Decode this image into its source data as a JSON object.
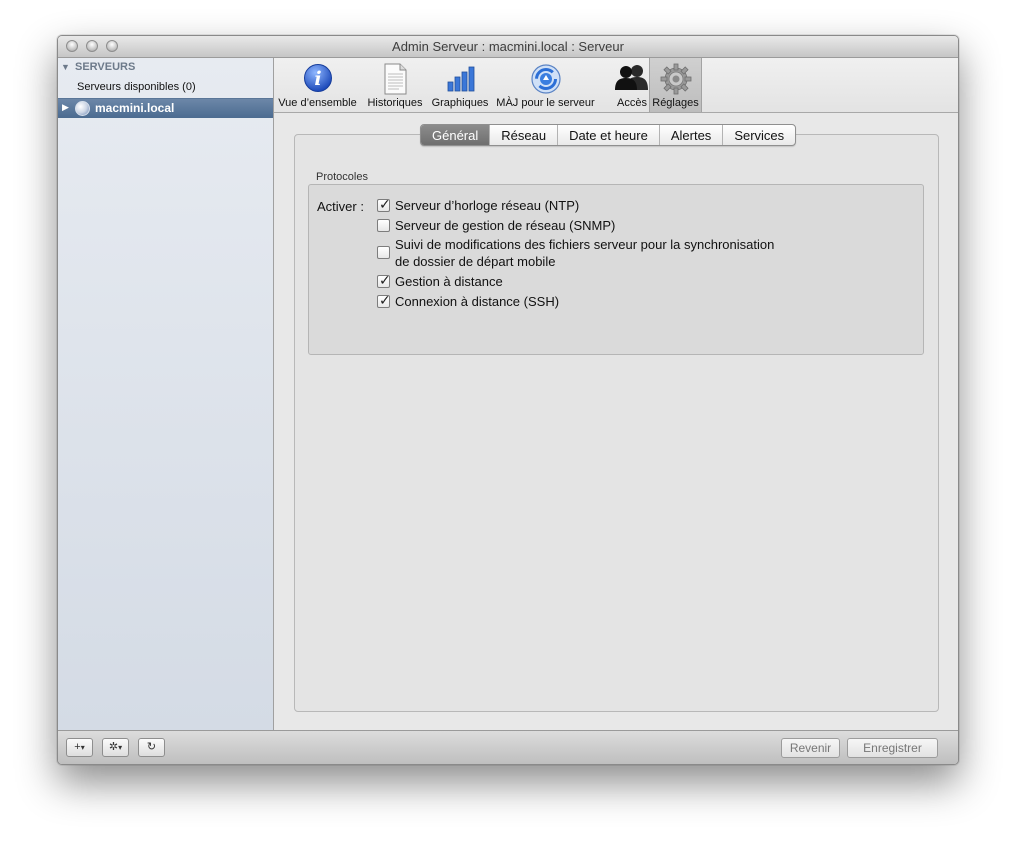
{
  "window": {
    "title": "Admin Serveur : macmini.local : Serveur"
  },
  "sidebar": {
    "header": "SERVEURS",
    "available": "Serveurs disponibles (0)",
    "selected": "macmini.local"
  },
  "toolbar": {
    "items": [
      {
        "label": "Vue d’ensemble",
        "icon": "info-icon"
      },
      {
        "label": "Historiques",
        "icon": "document-icon"
      },
      {
        "label": "Graphiques",
        "icon": "bar-chart-icon"
      },
      {
        "label": "MÀJ pour le serveur",
        "icon": "software-update-icon"
      },
      {
        "label": "Accès",
        "icon": "users-icon"
      },
      {
        "label": "Réglages",
        "icon": "gear-icon",
        "selected": true
      }
    ]
  },
  "tabs": [
    {
      "label": "Général",
      "active": true
    },
    {
      "label": "Réseau"
    },
    {
      "label": "Date et heure"
    },
    {
      "label": "Alertes"
    },
    {
      "label": "Services"
    }
  ],
  "protocols": {
    "group_label": "Protocoles",
    "activate_label": "Activer :",
    "options": [
      {
        "label": "Serveur d’horloge réseau (NTP)",
        "checked": true
      },
      {
        "label": "Serveur de gestion de réseau (SNMP)",
        "checked": false
      },
      {
        "label": "Suivi de modifications des fichiers serveur pour la synchronisation",
        "label2": "de dossier de départ mobile",
        "checked": false
      },
      {
        "label": "Gestion à distance",
        "checked": true
      },
      {
        "label": "Connexion à distance (SSH)",
        "checked": true
      }
    ]
  },
  "bottom": {
    "add": "+",
    "action": "✲",
    "refresh": "↻",
    "revert": "Revenir",
    "save": "Enregistrer"
  }
}
